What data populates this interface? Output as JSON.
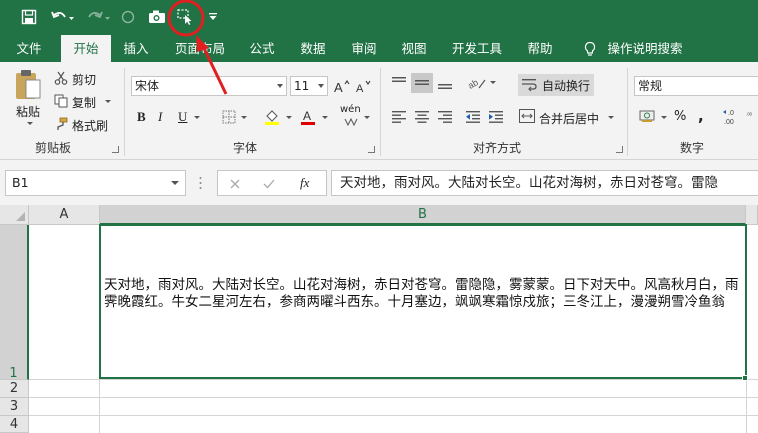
{
  "quick_access": {
    "save_icon": "save-icon",
    "undo_icon": "undo-icon",
    "redo_icon": "redo-icon",
    "circle_icon": "circle-icon",
    "camera_icon": "camera-icon",
    "highlighted_icon": "select-cursor-icon",
    "customize_icon": "customize-dropdown-icon",
    "highlight_color": "#e02020"
  },
  "tabs": [
    "文件",
    "开始",
    "插入",
    "页面布局",
    "公式",
    "数据",
    "审阅",
    "视图",
    "开发工具",
    "帮助",
    "操作说明搜索"
  ],
  "active_tab": "开始",
  "ribbon": {
    "clipboard": {
      "paste": "粘贴",
      "cut": "剪切",
      "copy": "复制",
      "format_painter": "格式刷",
      "label": "剪贴板"
    },
    "font": {
      "font_name": "宋体",
      "font_size": "11",
      "bold": "B",
      "italic": "I",
      "underline": "U",
      "phonetic": "wén",
      "label": "字体"
    },
    "alignment": {
      "wrap_text": "自动换行",
      "merge_center": "合并后居中",
      "label": "对齐方式"
    },
    "number": {
      "format": "常规",
      "percent": "%",
      "comma": ",",
      "label": "数字"
    }
  },
  "formula_bar": {
    "name_box": "B1",
    "fx": "fx",
    "content": "天对地，雨对风。大陆对长空。山花对海树，赤日对苍穹。雷隐"
  },
  "grid": {
    "columns": [
      "A",
      "B"
    ],
    "rows": [
      "1",
      "2",
      "3",
      "4"
    ],
    "selected_cell": "B1",
    "cell_b1": "天对地，雨对风。大陆对长空。山花对海树，赤日对苍穹。雷隐隐，雾蒙蒙。日下对天中。风高秋月白，雨霁晚霞红。牛女二星河左右，参商两曜斗西东。十月塞边，飒飒寒霜惊戍旅；三冬江上，漫漫朔雪冷鱼翁"
  },
  "colors": {
    "brand_green": "#217346",
    "annotation_red": "#e02020"
  }
}
